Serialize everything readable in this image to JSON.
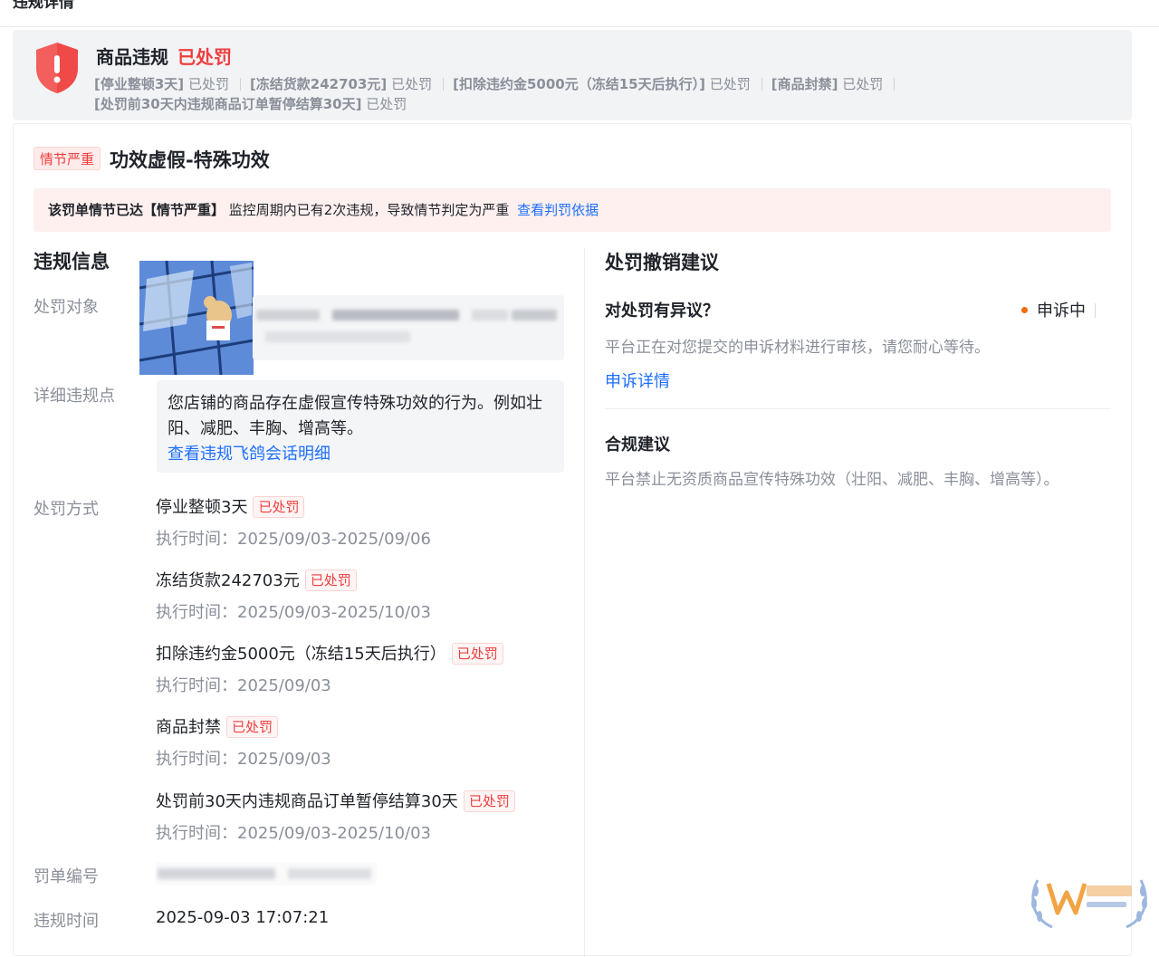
{
  "page": {
    "top_title": "违规详情"
  },
  "banner": {
    "title": "商品违规",
    "status": "已处罚",
    "penalties_line1": [
      {
        "name": "[停业整顿3天]",
        "status": "已处罚"
      },
      {
        "name": "[冻结货款242703元]",
        "status": "已处罚"
      },
      {
        "name": "[扣除违约金5000元（冻结15天后执行）]",
        "status": "已处罚"
      },
      {
        "name": "[商品封禁]",
        "status": "已处罚"
      }
    ],
    "penalties_line2": [
      {
        "name": "[处罚前30天内违规商品订单暂停结算30天]",
        "status": "已处罚"
      }
    ]
  },
  "violation": {
    "severity_tag": "情节严重",
    "title": "功效虚假-特殊功效",
    "alert": {
      "bold": "该罚单情节已达【情节严重】",
      "text": "监控周期内已有2次违规，导致情节判定为严重",
      "link": "查看判罚依据"
    }
  },
  "info": {
    "section_title": "违规信息",
    "target_label": "处罚对象",
    "detail_label": "详细违规点",
    "detail_text": "您店铺的商品存在虚假宣传特殊功效的行为。例如壮阳、减肥、丰胸、增高等。",
    "detail_link": "查看违规飞鸽会话明细",
    "method_label": "处罚方式",
    "punishments": [
      {
        "name": "停业整顿3天",
        "tag": "已处罚",
        "time": "执行时间：2025/09/03-2025/09/06"
      },
      {
        "name": "冻结货款242703元",
        "tag": "已处罚",
        "time": "执行时间：2025/09/03-2025/10/03"
      },
      {
        "name": "扣除违约金5000元（冻结15天后执行）",
        "tag": "已处罚",
        "time": "执行时间：2025/09/03"
      },
      {
        "name": "商品封禁",
        "tag": "已处罚",
        "time": "执行时间：2025/09/03"
      },
      {
        "name": "处罚前30天内违规商品订单暂停结算30天",
        "tag": "已处罚",
        "time": "执行时间：2025/09/03-2025/10/03"
      }
    ],
    "ticket_label": "罚单编号",
    "time_label": "违规时间",
    "time_value": "2025-09-03 17:07:21"
  },
  "revoke": {
    "section_title": "处罚撤销建议",
    "question": "对处罚有异议？",
    "status": "申诉中",
    "review_text": "平台正在对您提交的申诉材料进行审核，请您耐心等待。",
    "detail_link": "申诉详情",
    "compliance_title": "合规建议",
    "compliance_text": "平台禁止无资质商品宣传特殊功效（壮阳、减肥、丰胸、增高等）。"
  },
  "colors": {
    "danger": "#f03e3e",
    "link": "#1e6fff",
    "muted": "#8a8f99",
    "appeal_dot": "#f76808"
  }
}
